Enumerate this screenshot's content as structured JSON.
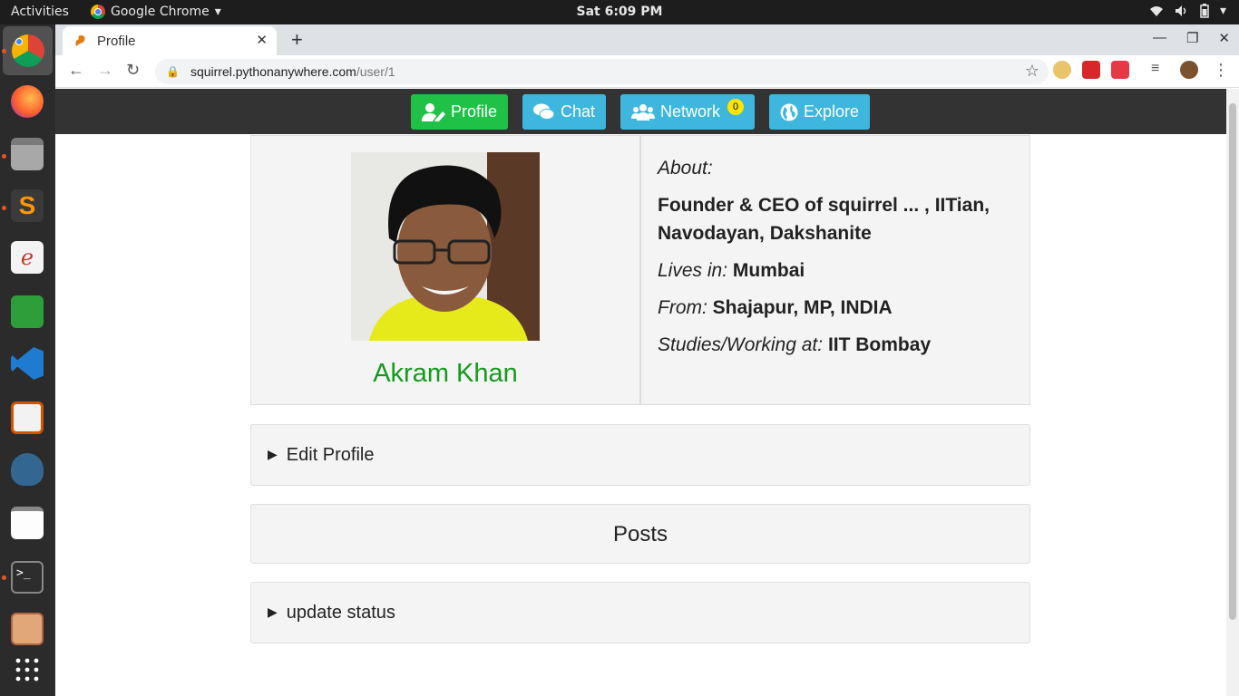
{
  "system_bar": {
    "activities": "Activities",
    "app_name": "Google Chrome",
    "clock": "Sat  6:09 PM"
  },
  "browser": {
    "tab_title": "Profile",
    "url_host": "squirrel.pythonanywhere.com",
    "url_path": "/user/1"
  },
  "site_nav": {
    "profile": "Profile",
    "chat": "Chat",
    "network": "Network",
    "network_badge": "0",
    "explore": "Explore"
  },
  "profile": {
    "name": "Akram Khan",
    "about_label": "About:",
    "about_value": "Founder & CEO of squirrel ... , IITian, Navodayan, Dakshanite",
    "lives_label": "Lives in:",
    "lives_value": "Mumbai",
    "from_label": "From:",
    "from_value": "Shajapur, MP, INDIA",
    "studies_label": "Studies/Working at:",
    "studies_value": "IIT Bombay"
  },
  "panels": {
    "edit_profile": "Edit Profile",
    "posts": "Posts",
    "update_status": "update status"
  },
  "colors": {
    "nav_bg": "#333333",
    "profile_btn": "#1fc147",
    "blue_btn": "#3eb6dd",
    "name_green": "#159a1c",
    "badge_yellow": "#ffe600"
  }
}
